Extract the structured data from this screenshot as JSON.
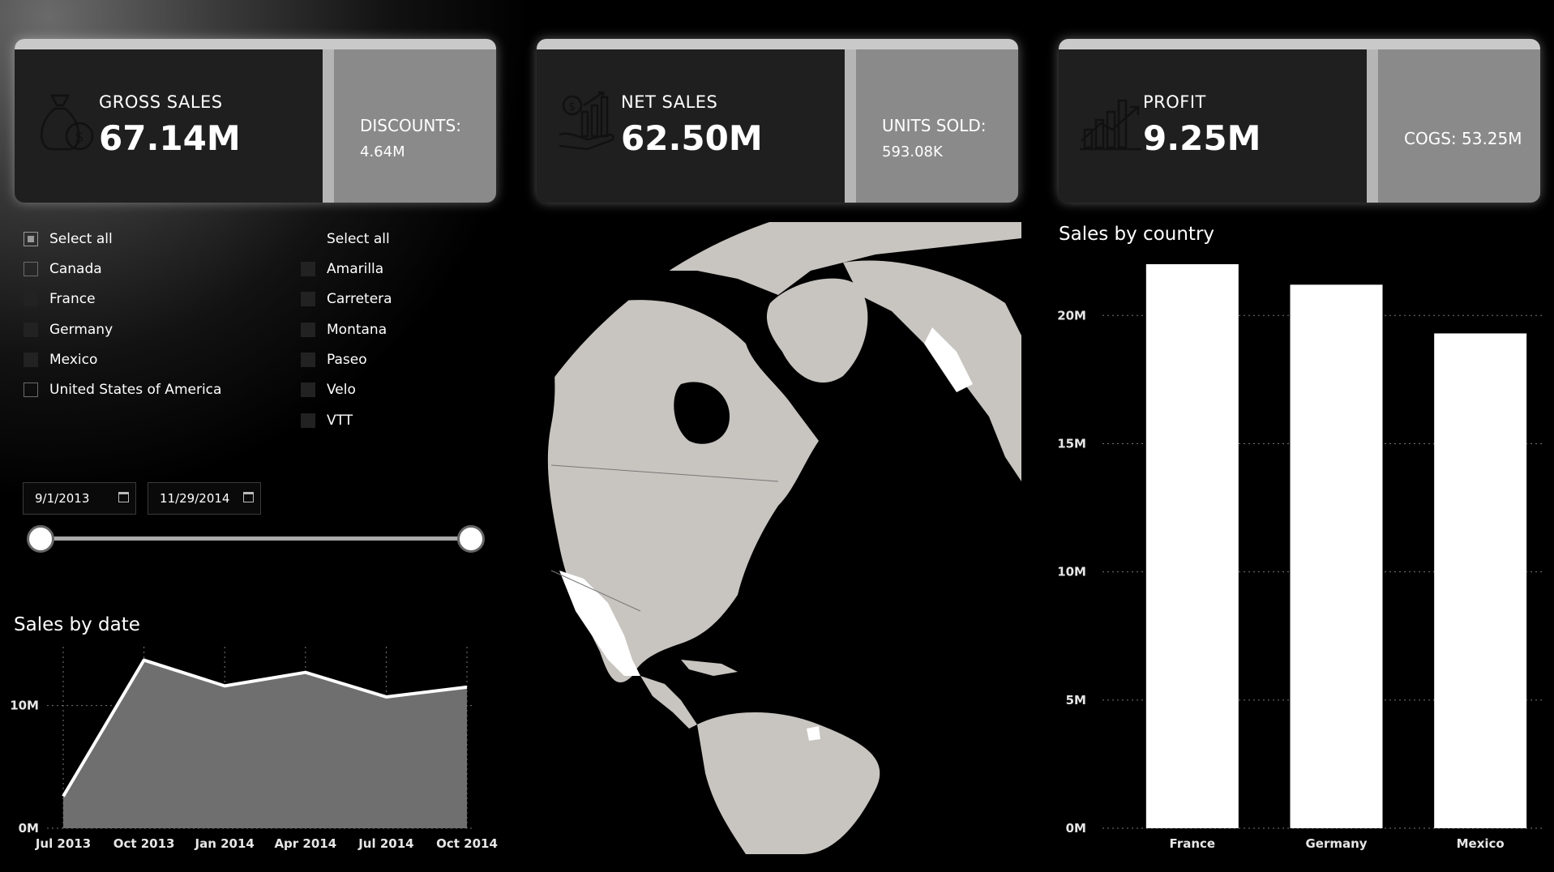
{
  "cards": [
    {
      "label": "GROSS SALES",
      "value": "67.14M",
      "side_label": "DISCOUNTS:",
      "side_value": "4.64M",
      "icon": "money-bag-icon"
    },
    {
      "label": "NET SALES",
      "value": "62.50M",
      "side_label": "UNITS SOLD:",
      "side_value": "593.08K",
      "icon": "hand-money-chart-icon"
    },
    {
      "label": "PROFIT",
      "value": "9.25M",
      "side_single": "COGS: 53.25M",
      "icon": "growth-chart-icon"
    }
  ],
  "country_slicer": {
    "select_all": "Select all",
    "items": [
      {
        "label": "Canada",
        "state": "unchecked"
      },
      {
        "label": "France",
        "state": "checked"
      },
      {
        "label": "Germany",
        "state": "checked"
      },
      {
        "label": "Mexico",
        "state": "checked"
      },
      {
        "label": "United States of America",
        "state": "unchecked"
      }
    ]
  },
  "product_slicer": {
    "select_all": "Select all",
    "items": [
      {
        "label": "Amarilla"
      },
      {
        "label": "Carretera"
      },
      {
        "label": "Montana"
      },
      {
        "label": "Paseo"
      },
      {
        "label": "Velo"
      },
      {
        "label": "VTT"
      }
    ]
  },
  "date_range": {
    "start": "9/1/2013",
    "end": "11/29/2014"
  },
  "sales_by_date": {
    "title": "Sales by date",
    "chart_data": {
      "type": "area",
      "x": [
        "Jul 2013",
        "Oct 2013",
        "Jan 2014",
        "Apr 2014",
        "Jul 2014",
        "Oct 2014"
      ],
      "values": [
        2.6,
        13.7,
        11.6,
        12.7,
        10.7,
        11.5
      ],
      "unit": "M",
      "y_ticks": [
        "0M",
        "10M"
      ],
      "ylim": [
        0,
        14
      ]
    }
  },
  "sales_by_country": {
    "title": "Sales by country",
    "chart_data": {
      "type": "bar",
      "categories": [
        "France",
        "Germany",
        "Mexico"
      ],
      "values": [
        22.0,
        21.2,
        19.3
      ],
      "unit": "M",
      "y_ticks": [
        "0M",
        "5M",
        "10M",
        "15M",
        "20M"
      ],
      "ylim": [
        0,
        22
      ]
    }
  },
  "colors": {
    "background": "#000000",
    "card": "#1f1f1f",
    "card_side": "#8a8a8a",
    "land": "#c8c5c0",
    "highlight": "#ffffff"
  }
}
